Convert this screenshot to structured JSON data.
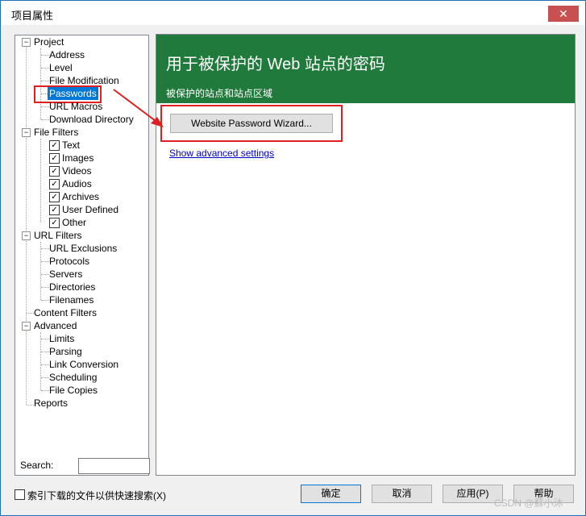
{
  "window": {
    "title": "项目属性",
    "close_glyph": "✕"
  },
  "tree": {
    "project": "Project",
    "address": "Address",
    "level": "Level",
    "file_modification": "File Modification",
    "passwords": "Passwords",
    "url_macros": "URL Macros",
    "download_directory": "Download Directory",
    "file_filters": "File Filters",
    "text": "Text",
    "images": "Images",
    "videos": "Videos",
    "audios": "Audios",
    "archives": "Archives",
    "user_defined": "User Defined",
    "other": "Other",
    "url_filters": "URL Filters",
    "url_exclusions": "URL Exclusions",
    "protocols": "Protocols",
    "servers": "Servers",
    "directories": "Directories",
    "filenames": "Filenames",
    "content_filters": "Content Filters",
    "advanced": "Advanced",
    "limits": "Limits",
    "parsing": "Parsing",
    "link_conversion": "Link Conversion",
    "scheduling": "Scheduling",
    "file_copies": "File Copies",
    "reports": "Reports"
  },
  "search": {
    "label": "Search:",
    "value": ""
  },
  "content": {
    "title": "用于被保护的 Web 站点的密码",
    "subtitle": "被保护的站点和站点区域",
    "wizard_button": "Website Password Wizard...",
    "advanced_link": "Show advanced settings"
  },
  "footer": {
    "index_label": "索引下载的文件以供快速搜索(X)",
    "ok": "确定",
    "cancel": "取消",
    "apply": "应用(P)",
    "help": "帮助"
  },
  "watermark": "CSDN @蘇小沐",
  "colors": {
    "header_green": "#1f7a3b",
    "selection_blue": "#0078d7",
    "annotation_red": "#e02020"
  }
}
